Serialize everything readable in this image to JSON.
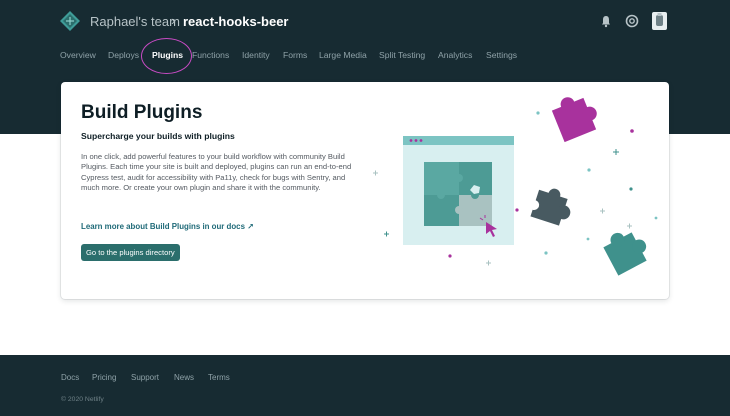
{
  "header": {
    "team_name": "Raphael's team",
    "separator": "›",
    "site_name": "react-hooks-beer",
    "icons": [
      "bell-icon",
      "help-icon",
      "user-avatar"
    ]
  },
  "nav": {
    "items": [
      {
        "label": "Overview",
        "active": false
      },
      {
        "label": "Deploys",
        "active": false
      },
      {
        "label": "Plugins",
        "active": true
      },
      {
        "label": "Functions",
        "active": false
      },
      {
        "label": "Identity",
        "active": false
      },
      {
        "label": "Forms",
        "active": false
      },
      {
        "label": "Large Media",
        "active": false
      },
      {
        "label": "Split Testing",
        "active": false
      },
      {
        "label": "Analytics",
        "active": false
      },
      {
        "label": "Settings",
        "active": false
      }
    ]
  },
  "card": {
    "title": "Build Plugins",
    "subtitle": "Supercharge your builds with plugins",
    "body": "In one click, add powerful features to your build workflow with community Build Plugins. Each time your site is built and deployed, plugins can run an end-to-end Cypress test, audit for accessibility with Pa11y, check for bugs with Sentry, and much more. Or create your own plugin and share it with the community.",
    "link_label": "Learn more about Build Plugins in our docs ↗",
    "button_label": "Go to the plugins directory"
  },
  "footer": {
    "links": [
      "Docs",
      "Pricing",
      "Support",
      "News",
      "Terms"
    ],
    "copyright": "© 2020 Netlify"
  },
  "colors": {
    "dark_bg": "#172b32",
    "teal": "#2b6e6c",
    "magenta": "#a8329d",
    "slate": "#485a61",
    "highlight_circle": "#c84bc4"
  }
}
